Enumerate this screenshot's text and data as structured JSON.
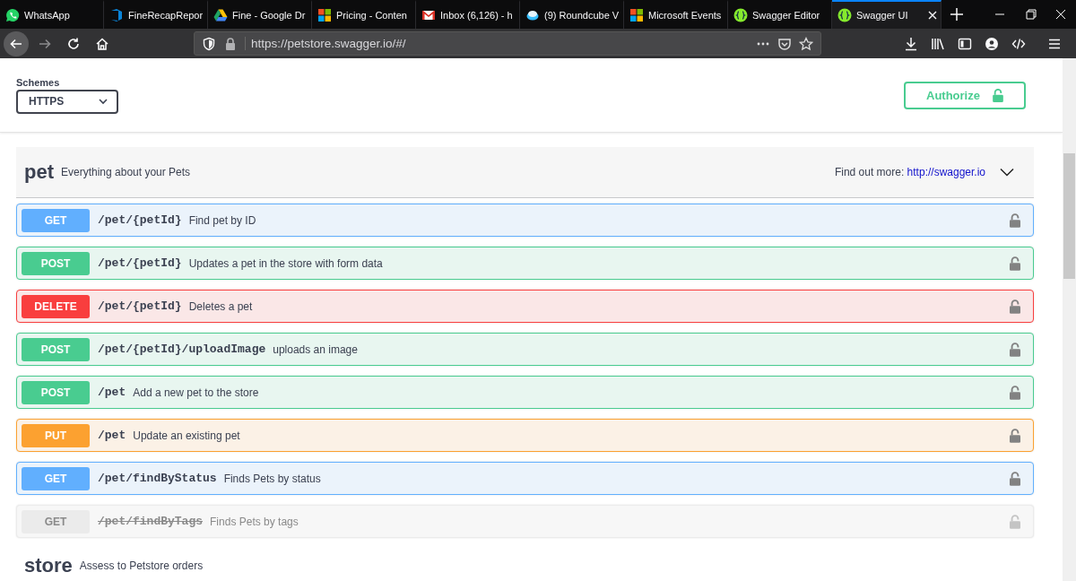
{
  "browser": {
    "tabs": [
      {
        "title": "WhatsApp",
        "kind": "chat",
        "selected": false
      },
      {
        "title": "FineRecapRepor",
        "kind": "bracket",
        "selected": false
      },
      {
        "title": "Fine - Google Dr",
        "kind": "triangle",
        "selected": false
      },
      {
        "title": "Pricing - Conten",
        "kind": "squares",
        "selected": false
      },
      {
        "title": "Inbox (6,126) - h",
        "kind": "mail",
        "selected": false
      },
      {
        "title": "(9) Roundcube V",
        "kind": "cloud",
        "selected": false
      },
      {
        "title": "Microsoft Events",
        "kind": "squares",
        "selected": false
      },
      {
        "title": "Swagger Editor",
        "kind": "braces",
        "selected": false
      },
      {
        "title": "Swagger UI",
        "kind": "braces",
        "selected": true
      }
    ],
    "address": "https://petstore.swagger.io/#/"
  },
  "schemes": {
    "label": "Schemes",
    "value": "HTTPS"
  },
  "authorize": {
    "label": "Authorize"
  },
  "sections": [
    {
      "name": "pet",
      "description": "Everything about your Pets",
      "more_label": "Find out more:",
      "more_link": "http://swagger.io",
      "operations": [
        {
          "method": "GET",
          "path": "/pet/{petId}",
          "summary": "Find pet by ID",
          "deprecated": false
        },
        {
          "method": "POST",
          "path": "/pet/{petId}",
          "summary": "Updates a pet in the store with form data",
          "deprecated": false
        },
        {
          "method": "DELETE",
          "path": "/pet/{petId}",
          "summary": "Deletes a pet",
          "deprecated": false
        },
        {
          "method": "POST",
          "path": "/pet/{petId}/uploadImage",
          "summary": "uploads an image",
          "deprecated": false
        },
        {
          "method": "POST",
          "path": "/pet",
          "summary": "Add a new pet to the store",
          "deprecated": false
        },
        {
          "method": "PUT",
          "path": "/pet",
          "summary": "Update an existing pet",
          "deprecated": false
        },
        {
          "method": "GET",
          "path": "/pet/findByStatus",
          "summary": "Finds Pets by status",
          "deprecated": false
        },
        {
          "method": "GET",
          "path": "/pet/findByTags",
          "summary": "Finds Pets by tags",
          "deprecated": true
        }
      ]
    },
    {
      "name": "store",
      "description": "Assess to Petstore orders"
    }
  ]
}
